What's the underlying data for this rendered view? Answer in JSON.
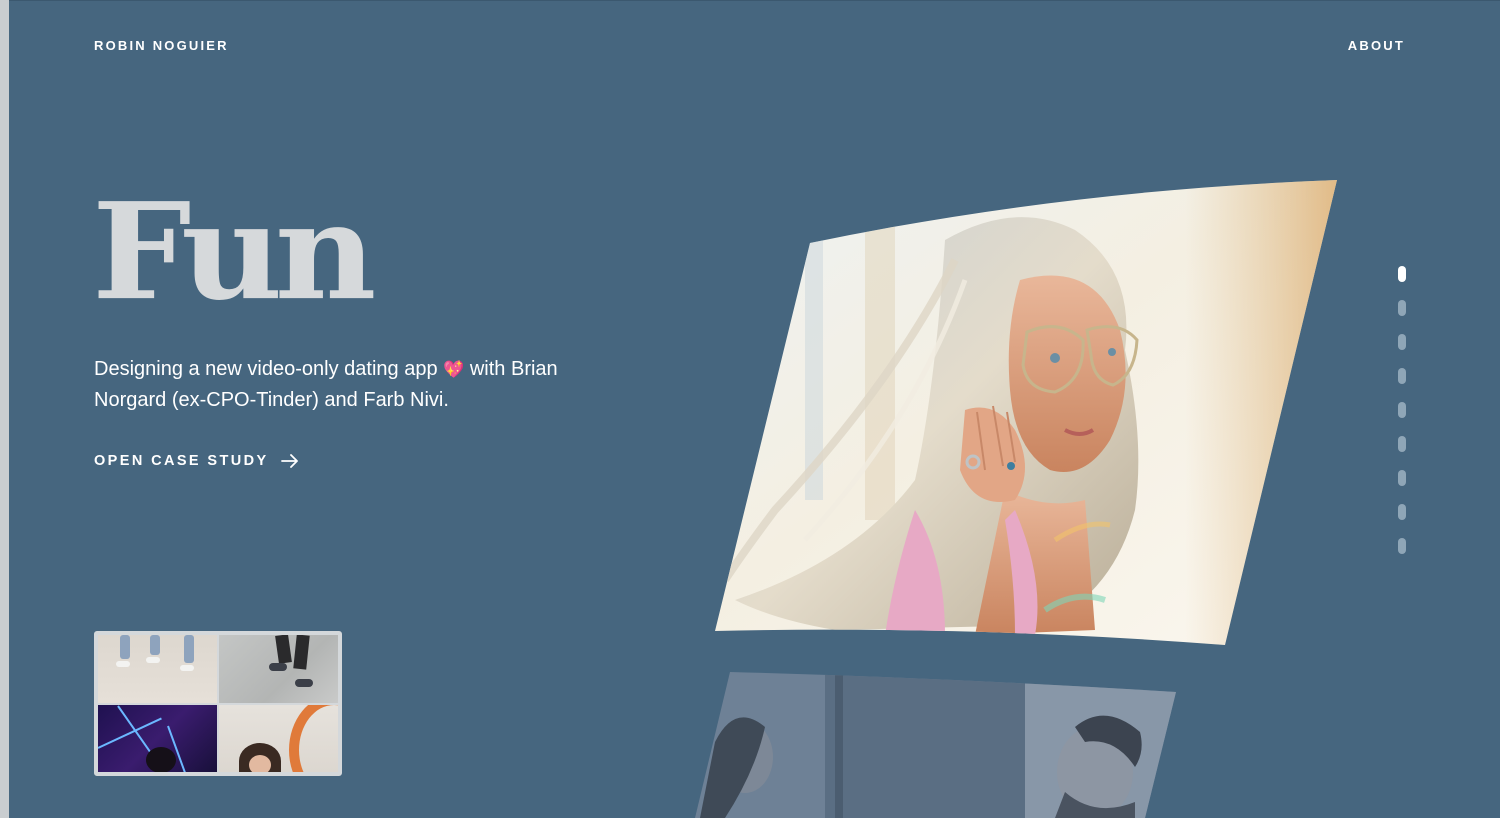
{
  "header": {
    "brand": "ROBIN NOGUIER",
    "nav_about": "ABOUT"
  },
  "hero": {
    "title": "Fun",
    "description_part1": "Designing a new video-only dating app ",
    "heart_emoji": "💖",
    "description_part2": " with Brian Norgard (ex-CPO-Tinder) and Farb Nivi.",
    "cta_label": "OPEN CASE STUDY"
  },
  "pager": {
    "total": 9,
    "active_index": 0
  },
  "icons": {
    "cta_arrow": "arrow-right-icon",
    "thumbnail": "video-grid-thumbnail",
    "hero_image": "woman-with-glasses-photo",
    "secondary_image": "two-people-photo"
  },
  "colors": {
    "background": "#46667f",
    "text": "#ffffff",
    "title": "#d6d9db",
    "dot_active": "#ffffff",
    "dot_inactive": "#8fa6b7"
  }
}
